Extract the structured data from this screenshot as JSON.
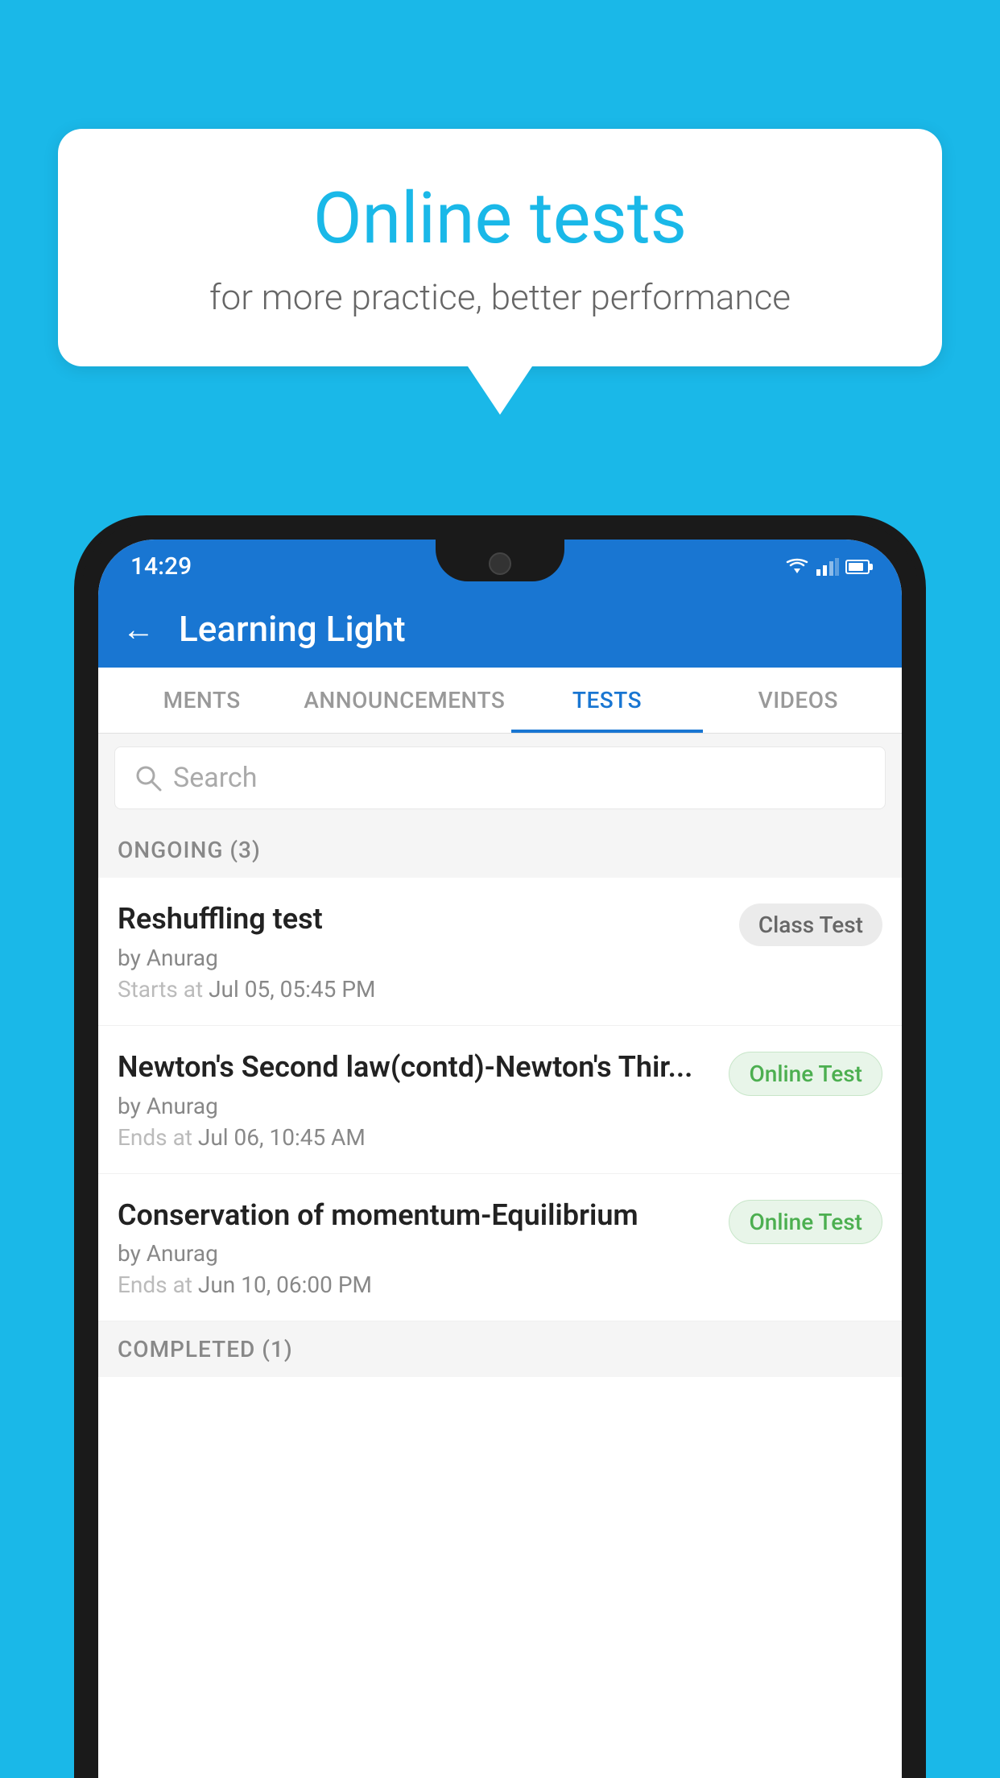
{
  "background": {
    "color": "#1AB8E8"
  },
  "speech_bubble": {
    "title": "Online tests",
    "subtitle": "for more practice, better performance"
  },
  "phone": {
    "status_bar": {
      "time": "14:29",
      "icons": [
        "wifi",
        "signal",
        "battery"
      ]
    },
    "app_header": {
      "back_label": "←",
      "title": "Learning Light"
    },
    "tabs": [
      {
        "label": "MENTS",
        "active": false
      },
      {
        "label": "ANNOUNCEMENTS",
        "active": false
      },
      {
        "label": "TESTS",
        "active": true
      },
      {
        "label": "VIDEOS",
        "active": false
      }
    ],
    "search": {
      "placeholder": "Search"
    },
    "ongoing_section": {
      "label": "ONGOING (3)"
    },
    "test_items": [
      {
        "name": "Reshuffling test",
        "author": "by Anurag",
        "time_label": "Starts at",
        "time_value": "Jul 05, 05:45 PM",
        "badge": "Class Test",
        "badge_type": "class"
      },
      {
        "name": "Newton's Second law(contd)-Newton's Thir...",
        "author": "by Anurag",
        "time_label": "Ends at",
        "time_value": "Jul 06, 10:45 AM",
        "badge": "Online Test",
        "badge_type": "online"
      },
      {
        "name": "Conservation of momentum-Equilibrium",
        "author": "by Anurag",
        "time_label": "Ends at",
        "time_value": "Jun 10, 06:00 PM",
        "badge": "Online Test",
        "badge_type": "online"
      }
    ],
    "completed_section": {
      "label": "COMPLETED (1)"
    }
  }
}
